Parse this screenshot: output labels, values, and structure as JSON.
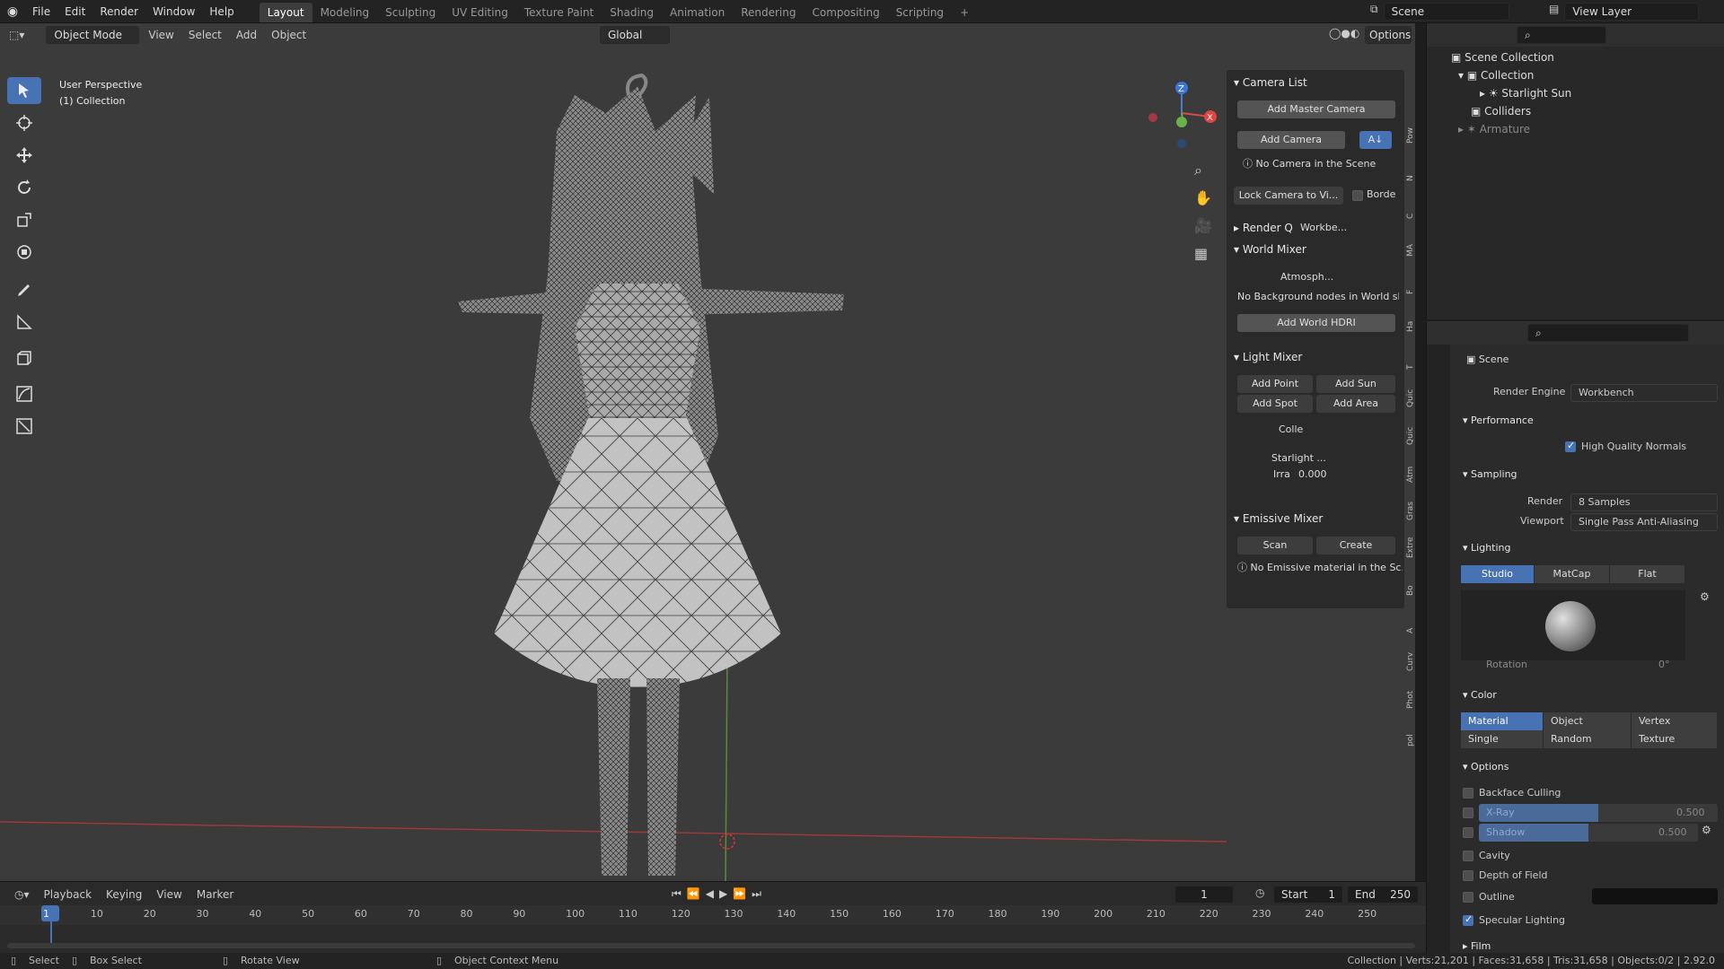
{
  "app": {
    "workspace_tabs": [
      "Layout",
      "Modeling",
      "Sculpting",
      "UV Editing",
      "Texture Paint",
      "Shading",
      "Animation",
      "Rendering",
      "Compositing",
      "Scripting"
    ],
    "menu": [
      "File",
      "Edit",
      "Render",
      "Window",
      "Help"
    ],
    "scene_field": "Scene",
    "view_layer_field": "View Layer"
  },
  "viewport_header": {
    "mode": "Object Mode",
    "menus": [
      "View",
      "Select",
      "Add",
      "Object"
    ],
    "orientation": "Global",
    "options": "Options"
  },
  "viewport": {
    "title": "User Perspective",
    "collection": "(1) Collection"
  },
  "side_panel": {
    "camera_list": {
      "title": "Camera List",
      "add_master": "Add Master Camera",
      "add_camera": "Add Camera",
      "no_camera": "No Camera in the Scene",
      "lock": "Lock Camera to Vi...",
      "border": "Borde"
    },
    "render_q": {
      "title": "Render Q",
      "engine": "Workbe..."
    },
    "world_mixer": {
      "title": "World Mixer",
      "world": "Atmosph...",
      "note": "No Background nodes in World sh...",
      "add_hdri": "Add World HDRI"
    },
    "light_mixer": {
      "title": "Light Mixer",
      "add_point": "Add Point",
      "add_sun": "Add Sun",
      "add_spot": "Add Spot",
      "add_area": "Add Area",
      "collection": "Colle",
      "light": "Starlight ...",
      "irra": "Irra",
      "irra_value": "0.000"
    },
    "emissive_mixer": {
      "title": "Emissive Mixer",
      "scan": "Scan",
      "create": "Create",
      "note": "No Emissive material in the Sc..."
    },
    "tabs": [
      "Pow",
      "N",
      "C",
      "MA",
      "F",
      "Ha",
      "T",
      "Quic",
      "Quic",
      "Atm",
      "Gras",
      "Extre",
      "Bo",
      "A",
      "Curv",
      "Phot",
      "pol"
    ]
  },
  "outliner": {
    "items": [
      {
        "label": "Scene Collection"
      },
      {
        "label": "Collection"
      },
      {
        "label": "Starlight Sun"
      },
      {
        "label": "Colliders"
      },
      {
        "label": "Armature"
      }
    ]
  },
  "properties": {
    "scene": "Scene",
    "render_engine_label": "Render Engine",
    "render_engine": "Workbench",
    "performance": "Performance",
    "hq_normals": "High Quality Normals",
    "sampling": "Sampling",
    "render_label": "Render",
    "render_samples": "8 Samples",
    "viewport_label": "Viewport",
    "viewport_samples": "Single Pass Anti-Aliasing",
    "lighting": "Lighting",
    "lighting_opts": [
      "Studio",
      "MatCap",
      "Flat"
    ],
    "rotation": "Rotation",
    "rotation_value": "0°",
    "color": "Color",
    "color_opts": [
      "Material",
      "Object",
      "Vertex",
      "Single",
      "Random",
      "Texture"
    ],
    "options": "Options",
    "backface": "Backface Culling",
    "xray": "X-Ray",
    "xray_value": "0.500",
    "shadow": "Shadow",
    "shadow_value": "0.500",
    "cavity": "Cavity",
    "dof": "Depth of Field",
    "outline": "Outline",
    "specular": "Specular Lighting",
    "film": "Film"
  },
  "timeline": {
    "menus": [
      "Playback",
      "Keying",
      "View",
      "Marker"
    ],
    "current": "1",
    "start_label": "Start",
    "start": "1",
    "end_label": "End",
    "end": "250",
    "ticks": [
      "1",
      "10",
      "20",
      "30",
      "40",
      "50",
      "60",
      "70",
      "80",
      "90",
      "100",
      "110",
      "120",
      "130",
      "140",
      "150",
      "160",
      "170",
      "180",
      "190",
      "200",
      "210",
      "220",
      "230",
      "240",
      "250"
    ]
  },
  "status": {
    "select": "Select",
    "box_select": "Box Select",
    "rotate": "Rotate View",
    "context": "Object Context Menu",
    "stats": "Collection | Verts:21,201 | Faces:31,658 | Tris:31,658 | Objects:0/2 | 2.92.0"
  }
}
